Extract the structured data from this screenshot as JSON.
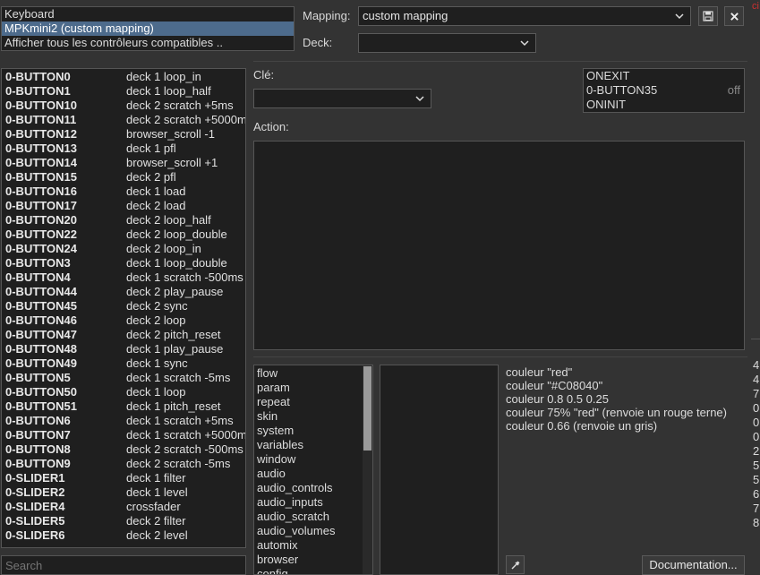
{
  "sources": {
    "items": [
      "Keyboard",
      "MPKmini2 (custom mapping)",
      "Afficher tous les contrôleurs compatibles .."
    ],
    "selected_index": 1
  },
  "header": {
    "mapping_label": "Mapping:",
    "mapping_value": "custom mapping",
    "deck_label": "Deck:",
    "deck_value": "",
    "save_icon": "floppy-disk-icon",
    "close_icon": "close-x-icon"
  },
  "mappings": [
    {
      "key": "0-BUTTON0",
      "action": "deck 1 loop_in"
    },
    {
      "key": "0-BUTTON1",
      "action": "deck 1 loop_half"
    },
    {
      "key": "0-BUTTON10",
      "action": "deck 2 scratch +5ms"
    },
    {
      "key": "0-BUTTON11",
      "action": "deck 2 scratch +5000m"
    },
    {
      "key": "0-BUTTON12",
      "action": "browser_scroll -1"
    },
    {
      "key": "0-BUTTON13",
      "action": "deck 1 pfl"
    },
    {
      "key": "0-BUTTON14",
      "action": "browser_scroll +1"
    },
    {
      "key": "0-BUTTON15",
      "action": "deck 2 pfl"
    },
    {
      "key": "0-BUTTON16",
      "action": "deck 1 load"
    },
    {
      "key": "0-BUTTON17",
      "action": "deck 2 load"
    },
    {
      "key": "0-BUTTON20",
      "action": "deck 2 loop_half"
    },
    {
      "key": "0-BUTTON22",
      "action": "deck 2 loop_double"
    },
    {
      "key": "0-BUTTON24",
      "action": "deck 2 loop_in"
    },
    {
      "key": "0-BUTTON3",
      "action": "deck 1 loop_double"
    },
    {
      "key": "0-BUTTON4",
      "action": "deck 1 scratch -500ms"
    },
    {
      "key": "0-BUTTON44",
      "action": "deck 2 play_pause"
    },
    {
      "key": "0-BUTTON45",
      "action": "deck 2 sync"
    },
    {
      "key": "0-BUTTON46",
      "action": "deck 2 loop"
    },
    {
      "key": "0-BUTTON47",
      "action": "deck 2 pitch_reset"
    },
    {
      "key": "0-BUTTON48",
      "action": "deck 1 play_pause"
    },
    {
      "key": "0-BUTTON49",
      "action": "deck 1 sync"
    },
    {
      "key": "0-BUTTON5",
      "action": "deck 1 scratch -5ms"
    },
    {
      "key": "0-BUTTON50",
      "action": "deck 1 loop"
    },
    {
      "key": "0-BUTTON51",
      "action": "deck 1 pitch_reset"
    },
    {
      "key": "0-BUTTON6",
      "action": "deck 1 scratch +5ms"
    },
    {
      "key": "0-BUTTON7",
      "action": "deck 1 scratch +5000m"
    },
    {
      "key": "0-BUTTON8",
      "action": "deck 2 scratch -500ms"
    },
    {
      "key": "0-BUTTON9",
      "action": "deck 2 scratch -5ms"
    },
    {
      "key": "0-SLIDER1",
      "action": "deck 1 filter"
    },
    {
      "key": "0-SLIDER2",
      "action": "deck 1 level"
    },
    {
      "key": "0-SLIDER4",
      "action": "crossfader"
    },
    {
      "key": "0-SLIDER5",
      "action": "deck 2 filter"
    },
    {
      "key": "0-SLIDER6",
      "action": "deck 2 level"
    }
  ],
  "search": {
    "placeholder": "Search"
  },
  "editor": {
    "key_label": "Clé:",
    "key_value": "",
    "action_label": "Action:",
    "action_value": ""
  },
  "events": [
    {
      "name": "ONEXIT",
      "state": ""
    },
    {
      "name": "0-BUTTON35",
      "state": "off"
    },
    {
      "name": "ONINIT",
      "state": ""
    }
  ],
  "categories": [
    "flow",
    "param",
    "repeat",
    "skin",
    "system",
    "variables",
    "window",
    "audio",
    "audio_controls",
    "audio_inputs",
    "audio_scratch",
    "audio_volumes",
    "automix",
    "browser",
    "config"
  ],
  "help": {
    "lines": [
      "couleur \"red\"",
      "couleur \"#C08040\"",
      "couleur 0.8 0.5 0.25",
      "couleur 75% \"red\" (renvoie un rouge terne)",
      "couleur 0.66 (renvoie un gris)"
    ],
    "documentation_button": "Documentation...",
    "picker_icon": "eyedropper-icon"
  },
  "edge": {
    "top_text": "ci",
    "digits": [
      "4",
      "4",
      "7",
      "0",
      "0",
      "0",
      "2",
      "5",
      "5",
      "6",
      "7",
      "8"
    ]
  },
  "colors": {
    "background": "#333333",
    "panel": "#1f1f1f",
    "selection": "#4d6b8c",
    "edge_red": "#d03030"
  }
}
